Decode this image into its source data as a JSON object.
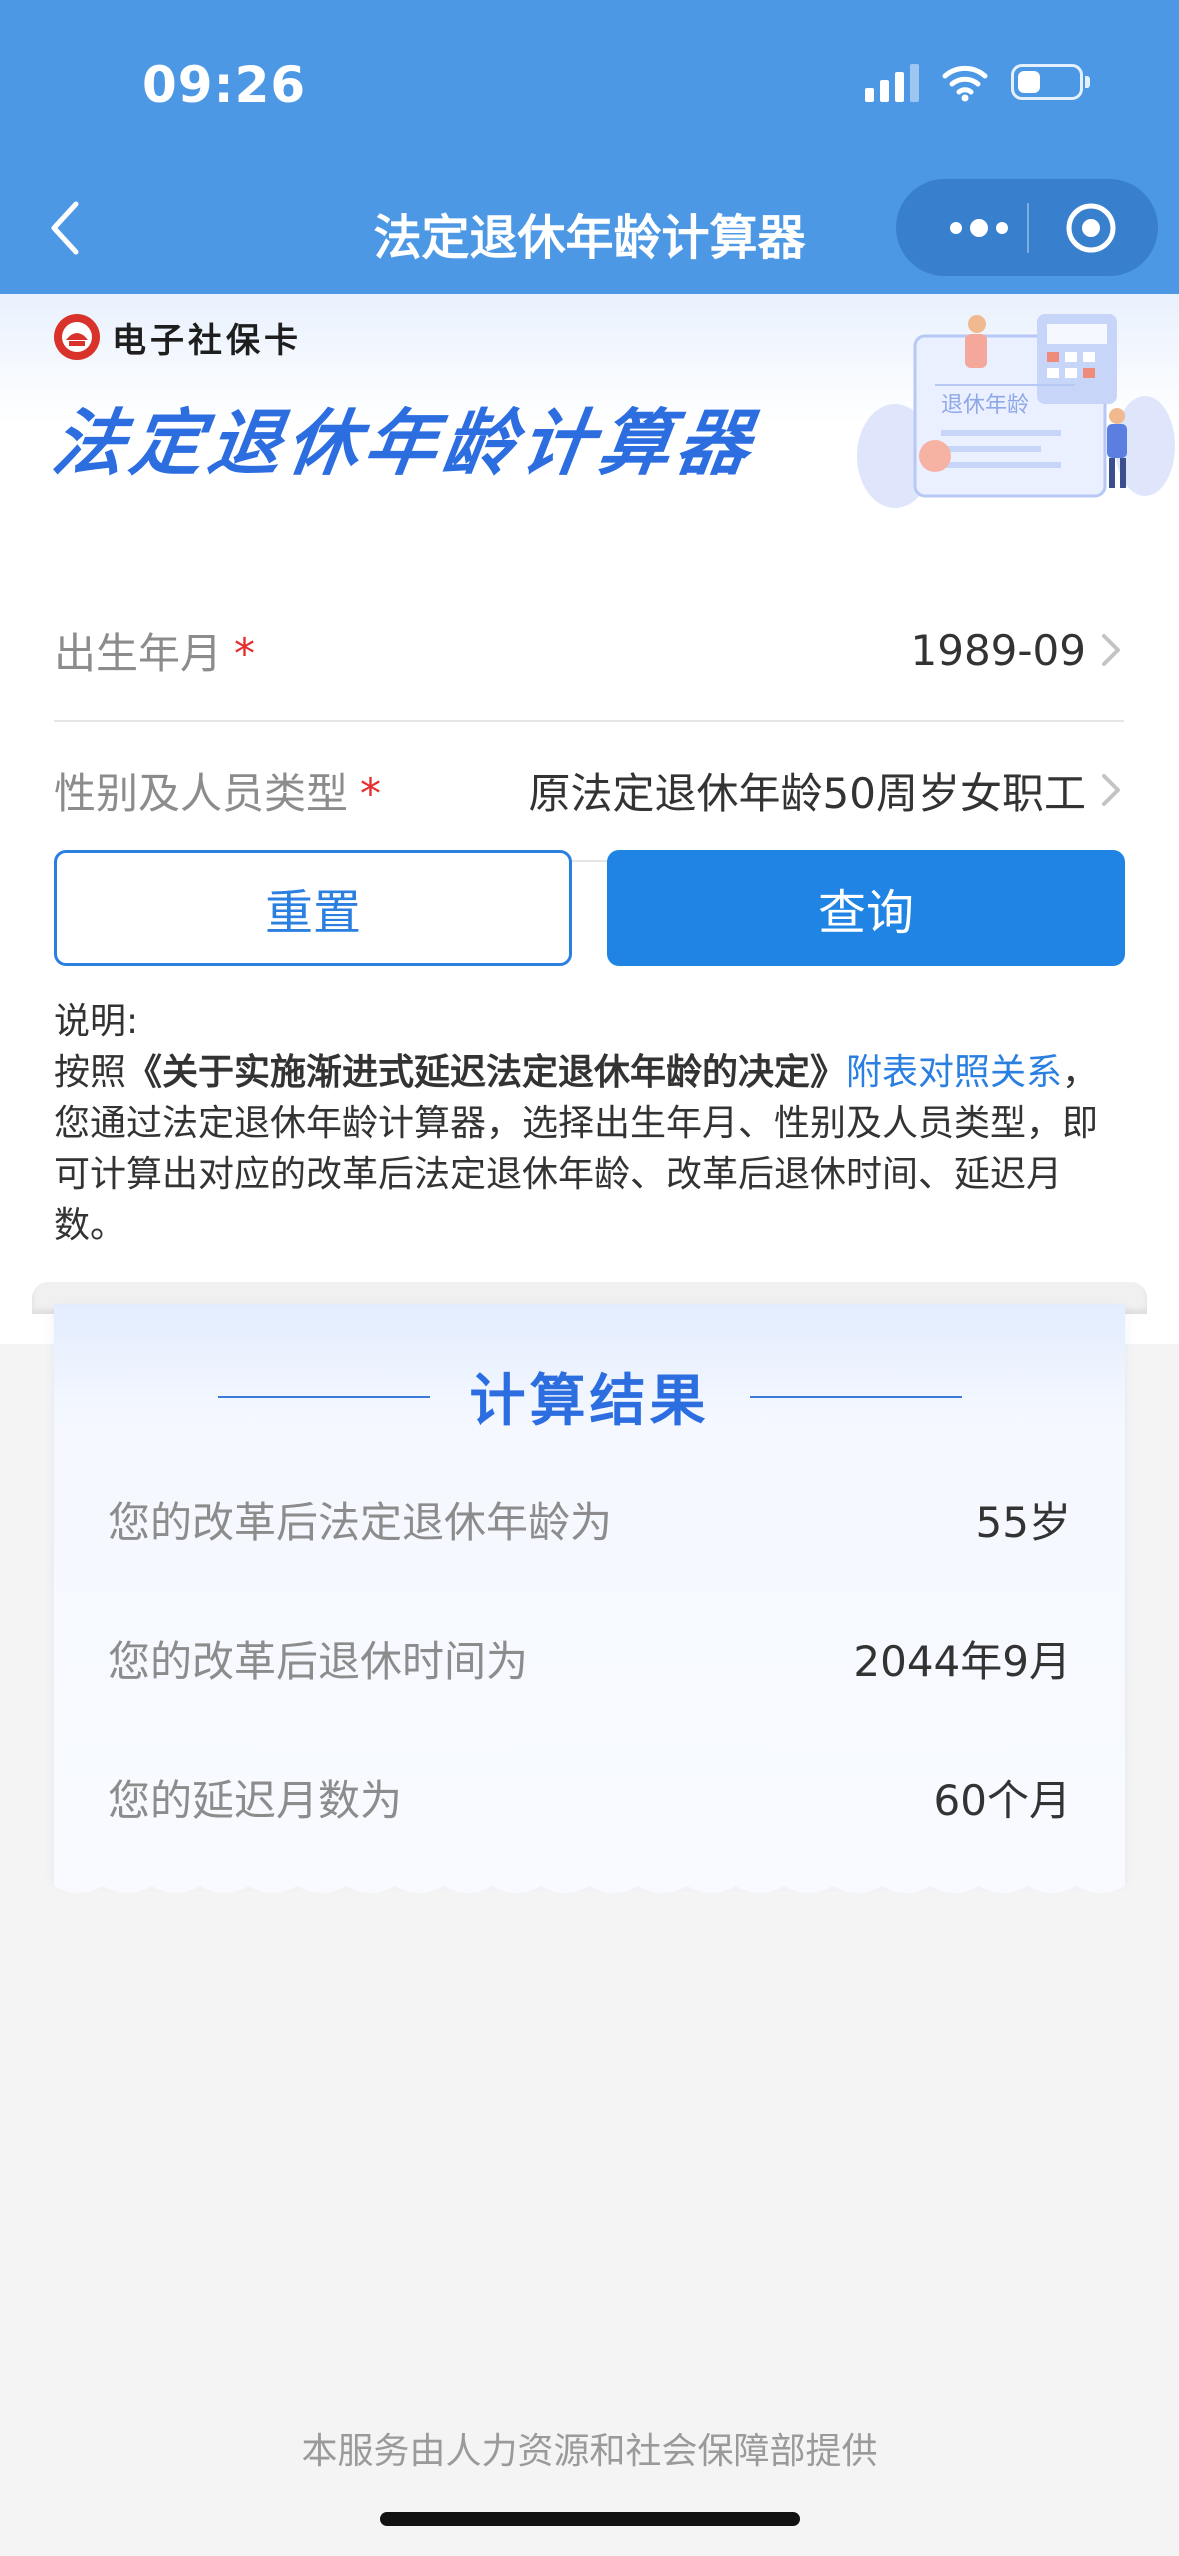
{
  "status_bar": {
    "time": "09:26"
  },
  "nav": {
    "title": "法定退休年龄计算器"
  },
  "banner": {
    "brand": "电子社保卡",
    "title": "法定退休年龄计算器",
    "illustration_label": "退休年龄"
  },
  "form": {
    "birth": {
      "label": "出生年月",
      "required_mark": "*",
      "value": "1989-09"
    },
    "type": {
      "label": "性别及人员类型",
      "required_mark": "*",
      "value": "原法定退休年龄50周岁女职工"
    }
  },
  "buttons": {
    "reset": "重置",
    "query": "查询"
  },
  "note": {
    "heading": "说明:",
    "prefix": "按照",
    "doc": "《关于实施渐进式延迟法定退休年龄的决定》",
    "link": "附表对照关系",
    "suffix": "，您通过法定退休年龄计算器，选择出生年月、性别及人员类型，即可计算出对应的改革后法定退休年龄、改革后退休时间、延迟月数。"
  },
  "result": {
    "title": "计算结果",
    "rows": [
      {
        "label": "您的改革后法定退休年龄为",
        "value": "55岁"
      },
      {
        "label": "您的改革后退休时间为",
        "value": "2044年9月"
      },
      {
        "label": "您的延迟月数为",
        "value": "60个月"
      }
    ]
  },
  "footer": {
    "text": "本服务由人力资源和社会保障部提供"
  },
  "colors": {
    "header": "#4d98e4",
    "primary": "#1f84e3",
    "required": "#e52d2d",
    "banner_title": "#2c6de0"
  }
}
